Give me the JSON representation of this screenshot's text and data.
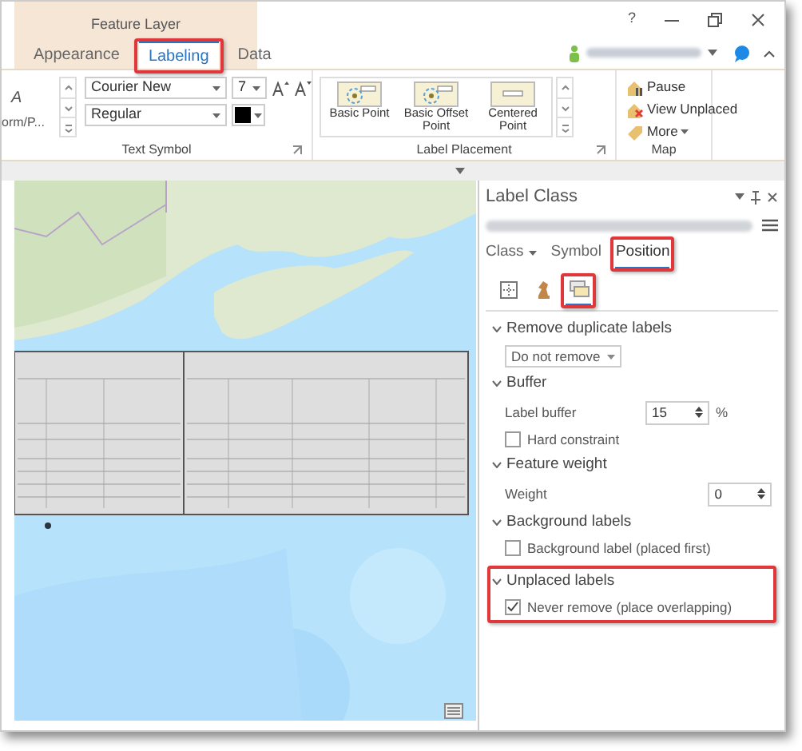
{
  "window": {
    "help": "?"
  },
  "context_tab_group": "Feature Layer",
  "tabs": [
    {
      "label": "Appearance",
      "selected": false,
      "highlighted": false
    },
    {
      "label": "Labeling",
      "selected": true,
      "highlighted": true
    },
    {
      "label": "Data",
      "selected": false,
      "highlighted": false
    }
  ],
  "ribbon": {
    "text_symbol": {
      "title": "Text Symbol",
      "gallery": [
        "A",
        "orm/P..."
      ],
      "font": "Courier New",
      "size": "7",
      "style": "Regular"
    },
    "label_placement": {
      "title": "Label Placement",
      "items": [
        {
          "label": "Basic Point",
          "kind": "point"
        },
        {
          "label": "Basic Offset Point",
          "kind": "point"
        },
        {
          "label": "Centered Point",
          "kind": "centered"
        }
      ]
    },
    "map": {
      "title": "Map",
      "items": [
        {
          "label": "Pause",
          "kind": "pause"
        },
        {
          "label": "View Unplaced",
          "kind": "unplaced"
        },
        {
          "label": "More",
          "kind": "more"
        }
      ]
    }
  },
  "label_class": {
    "title": "Label Class",
    "tabs": [
      {
        "label": "Class",
        "kind": "menu",
        "selected": false,
        "highlighted": false
      },
      {
        "label": "Symbol",
        "kind": "plain",
        "selected": false,
        "highlighted": false
      },
      {
        "label": "Position",
        "kind": "plain",
        "selected": true,
        "highlighted": true
      }
    ],
    "subtabs": [
      {
        "kind": "grid",
        "selected": false,
        "highlighted": false
      },
      {
        "kind": "chess",
        "selected": false,
        "highlighted": false
      },
      {
        "kind": "stack",
        "selected": true,
        "highlighted": true
      }
    ],
    "sections": [
      {
        "title": "Remove duplicate labels",
        "expanded": true,
        "highlighted": false,
        "items": [
          {
            "kind": "dropdown",
            "value": "Do not remove"
          }
        ]
      },
      {
        "title": "Buffer",
        "expanded": true,
        "highlighted": false,
        "items": [
          {
            "kind": "spinner",
            "label": "Label buffer",
            "value": "15",
            "unit": "%"
          },
          {
            "kind": "checkbox",
            "label": "Hard constraint",
            "checked": false
          }
        ]
      },
      {
        "title": "Feature weight",
        "expanded": true,
        "highlighted": false,
        "items": [
          {
            "kind": "spinner",
            "label": "Weight",
            "value": "0"
          }
        ]
      },
      {
        "title": "Background labels",
        "expanded": true,
        "highlighted": false,
        "items": [
          {
            "kind": "checkbox",
            "label": "Background label (placed first)",
            "checked": false
          }
        ]
      },
      {
        "title": "Unplaced labels",
        "expanded": true,
        "highlighted": true,
        "items": [
          {
            "kind": "checkbox",
            "label": "Never remove (place overlapping)",
            "checked": true
          }
        ]
      }
    ]
  }
}
